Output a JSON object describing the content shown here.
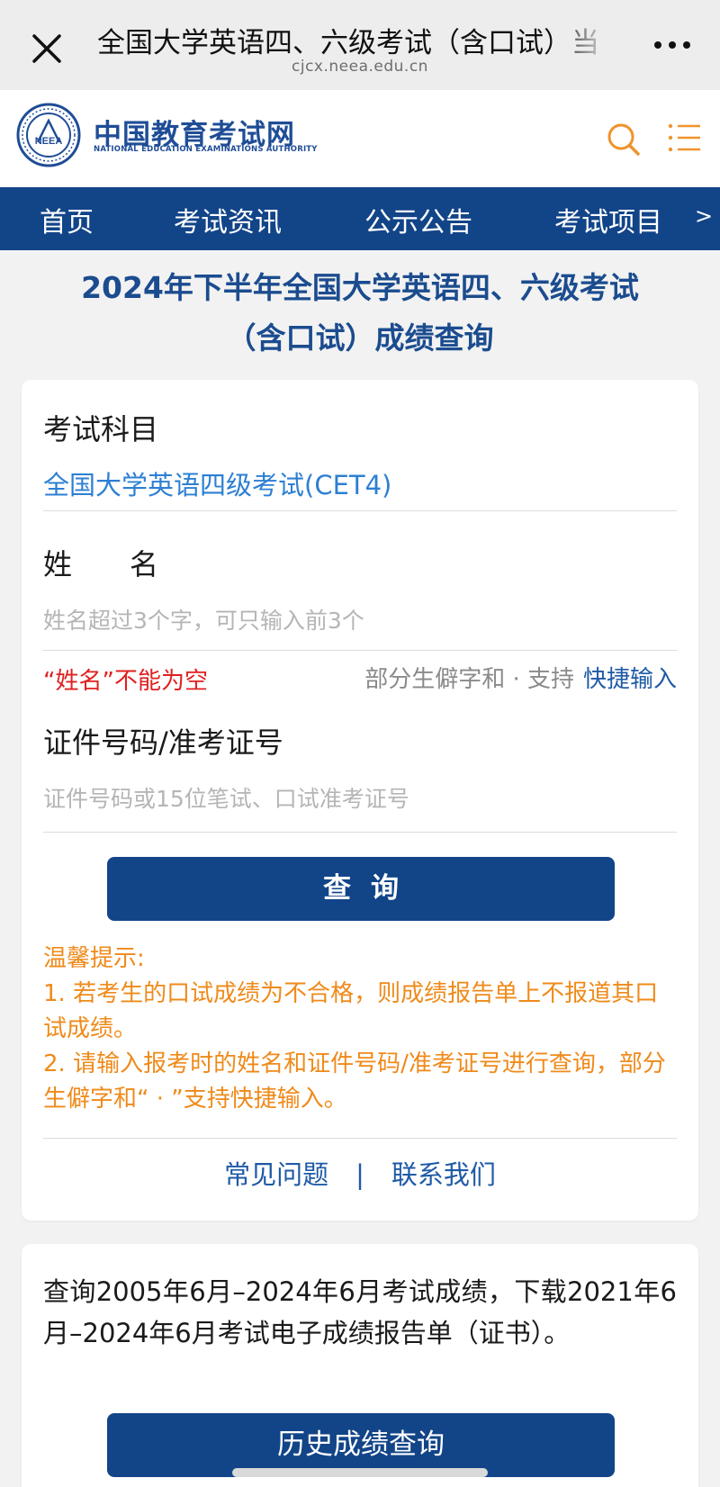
{
  "browser": {
    "title": "全国大学英语四、六级考试（含口试）当",
    "url": "cjcx.neea.edu.cn"
  },
  "header": {
    "logo_cn": "中国教育考试网",
    "logo_en": "NATIONAL EDUCATION EXAMINATIONS AUTHORITY",
    "emblem_text": "NEEA"
  },
  "nav": {
    "items": [
      "首页",
      "考试资讯",
      "公示公告",
      "考试项目"
    ],
    "more": ">"
  },
  "page": {
    "title_line1": "2024年下半年全国大学英语四、六级考试",
    "title_line2": "（含口试）成绩查询"
  },
  "form": {
    "subject_label": "考试科目",
    "subject_value": "全国大学英语四级考试(CET4)",
    "name_label": "姓　　名",
    "name_placeholder": "姓名超过3个字，可只输入前3个",
    "name_error": "“姓名”不能为空",
    "hint_text": "部分生僻字和 · 支持",
    "hint_link": "快捷输入",
    "id_label": "证件号码/准考证号",
    "id_placeholder": "证件号码或15位笔试、口试准考证号",
    "submit_label": "查询"
  },
  "tips": {
    "heading": "温馨提示:",
    "item1": "1. 若考生的口试成绩为不合格，则成绩报告单上不报道其口试成绩。",
    "item2": "2. 请输入报考时的姓名和证件号码/准考证号进行查询，部分生僻字和“ · ”支持快捷输入。"
  },
  "links": {
    "faq": "常见问题",
    "separator": "|",
    "contact": "联系我们"
  },
  "history": {
    "text": "查询2005年6月–2024年6月考试成绩，下载2021年6月–2024年6月考试电子成绩报告单（证书）。",
    "button": "历史成绩查询"
  },
  "colors": {
    "brand_blue": "#124488",
    "link_blue": "#1f5aa6",
    "value_blue": "#2d7fd3",
    "tip_orange": "#ef8a1a",
    "error_red": "#e02020",
    "search_orange": "#f0932b"
  },
  "icons": {
    "close": "close-icon",
    "more": "more-icon",
    "search": "search-icon",
    "menu": "menu-icon"
  }
}
